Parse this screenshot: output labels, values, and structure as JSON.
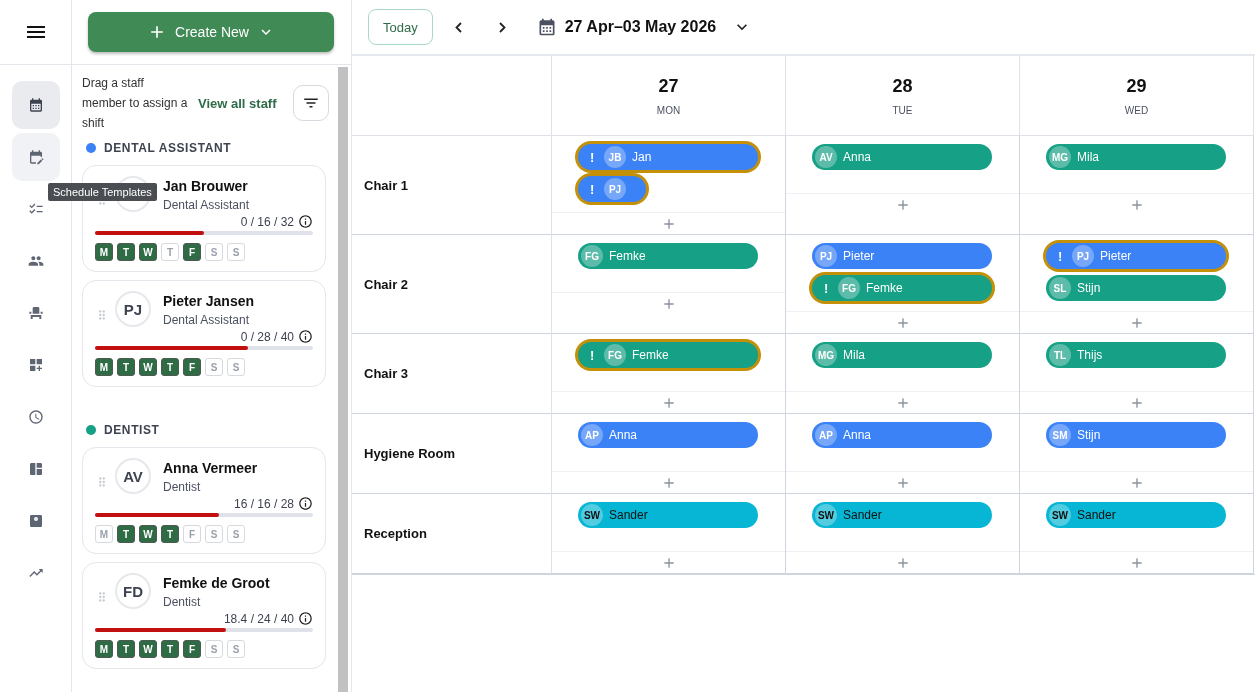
{
  "rail": {
    "items": [
      {
        "selected": true,
        "hovered": false
      },
      {
        "selected": false,
        "hovered": true
      },
      {
        "selected": false,
        "hovered": false
      },
      {
        "selected": false,
        "hovered": false
      },
      {
        "selected": false,
        "hovered": false
      },
      {
        "selected": false,
        "hovered": false
      },
      {
        "selected": false,
        "hovered": false
      },
      {
        "selected": false,
        "hovered": false
      },
      {
        "selected": false,
        "hovered": false
      },
      {
        "selected": false,
        "hovered": false
      }
    ],
    "tooltip": "Schedule Templates"
  },
  "staff_panel": {
    "create_button": "Create New",
    "hint": "Drag a staff member to assign a shift",
    "view_all": "View all staff",
    "groups": [
      {
        "name": "DENTAL ASSISTANT",
        "color": "#3b82f6",
        "staff": [
          {
            "name": "Jan Brouwer",
            "role": "Dental Assistant",
            "hours": "0 / 16 / 32",
            "level": 0.5,
            "days": [
              {
                "label": "M",
                "on": true
              },
              {
                "label": "T",
                "on": true
              },
              {
                "label": "W",
                "on": true
              },
              {
                "label": "T",
                "on": false
              },
              {
                "label": "F",
                "on": true
              },
              {
                "label": "S",
                "on": false
              },
              {
                "label": "S",
                "on": false
              }
            ]
          },
          {
            "initials": "PJ",
            "name": "Pieter Jansen",
            "role": "Dental Assistant",
            "hours": "0 / 28 / 40",
            "level": 0.7,
            "days": [
              {
                "label": "M",
                "on": true
              },
              {
                "label": "T",
                "on": true
              },
              {
                "label": "W",
                "on": true
              },
              {
                "label": "T",
                "on": true
              },
              {
                "label": "F",
                "on": true
              },
              {
                "label": "S",
                "on": false
              },
              {
                "label": "S",
                "on": false
              }
            ]
          }
        ]
      },
      {
        "name": "DENTIST",
        "color": "#16a085",
        "staff": [
          {
            "initials": "AV",
            "name": "Anna Vermeer",
            "role": "Dentist",
            "hours": "16 / 16 / 28",
            "level": 0.57,
            "days": [
              {
                "label": "M",
                "on": false
              },
              {
                "label": "T",
                "on": true
              },
              {
                "label": "W",
                "on": true
              },
              {
                "label": "T",
                "on": true
              },
              {
                "label": "F",
                "on": false
              },
              {
                "label": "S",
                "on": false
              },
              {
                "label": "S",
                "on": false
              }
            ]
          },
          {
            "initials": "FD",
            "name": "Femke de Groot",
            "role": "Dentist",
            "hours": "18.4 / 24 / 40",
            "level": 0.6,
            "days": [
              {
                "label": "M",
                "on": true
              },
              {
                "label": "T",
                "on": true
              },
              {
                "label": "W",
                "on": true
              },
              {
                "label": "T",
                "on": true
              },
              {
                "label": "F",
                "on": true
              },
              {
                "label": "S",
                "on": false
              },
              {
                "label": "S",
                "on": false
              }
            ]
          }
        ]
      }
    ]
  },
  "toolbar": {
    "today": "Today",
    "range": "27 Apr–03 May 2026"
  },
  "days": [
    {
      "date": "27",
      "weekday": "MON"
    },
    {
      "date": "28",
      "weekday": "TUE"
    },
    {
      "date": "29",
      "weekday": "WED"
    }
  ],
  "rows": [
    {
      "label": "Chair 1",
      "cells": [
        [
          {
            "initials": "JB",
            "name": "Jan",
            "color": "#3b82f6",
            "warning": "!"
          },
          {
            "initials": "PJ",
            "color": "#3b82f6",
            "warning": "!"
          }
        ],
        [
          {
            "initials": "AV",
            "name": "Anna",
            "color": "#16a085"
          }
        ],
        [
          {
            "initials": "MG",
            "name": "Mila",
            "color": "#16a085"
          }
        ]
      ]
    },
    {
      "label": "Chair 2",
      "cells": [
        [
          {
            "initials": "FG",
            "name": "Femke",
            "color": "#16a085"
          }
        ],
        [
          {
            "initials": "PJ",
            "name": "Pieter",
            "color": "#3b82f6"
          },
          {
            "initials": "FG",
            "name": "Femke",
            "color": "#16a085",
            "warning": "!"
          }
        ],
        [
          {
            "initials": "PJ",
            "name": "Pieter",
            "color": "#3b82f6",
            "warning": "!"
          },
          {
            "initials": "SL",
            "name": "Stijn",
            "color": "#16a085"
          }
        ]
      ]
    },
    {
      "label": "Chair 3",
      "cells": [
        [
          {
            "initials": "FG",
            "name": "Femke",
            "color": "#16a085",
            "warning": "!"
          }
        ],
        [
          {
            "initials": "MG",
            "name": "Mila",
            "color": "#16a085"
          }
        ],
        [
          {
            "initials": "TL",
            "name": "Thijs",
            "color": "#16a085"
          }
        ]
      ]
    },
    {
      "label": "Hygiene Room",
      "cells": [
        [
          {
            "initials": "AP",
            "name": "Anna",
            "color": "#3b82f6"
          }
        ],
        [
          {
            "initials": "AP",
            "name": "Anna",
            "color": "#3b82f6"
          }
        ],
        [
          {
            "initials": "SM",
            "name": "Stijn",
            "color": "#3b82f6"
          }
        ]
      ]
    },
    {
      "label": "Reception",
      "cells": [
        [
          {
            "initials": "SW",
            "name": "Sander",
            "color": "#06b6d4"
          }
        ],
        [
          {
            "initials": "SW",
            "name": "Sander",
            "color": "#06b6d4"
          }
        ],
        [
          {
            "initials": "SW",
            "name": "Sander",
            "color": "#06b6d4"
          }
        ]
      ]
    }
  ]
}
